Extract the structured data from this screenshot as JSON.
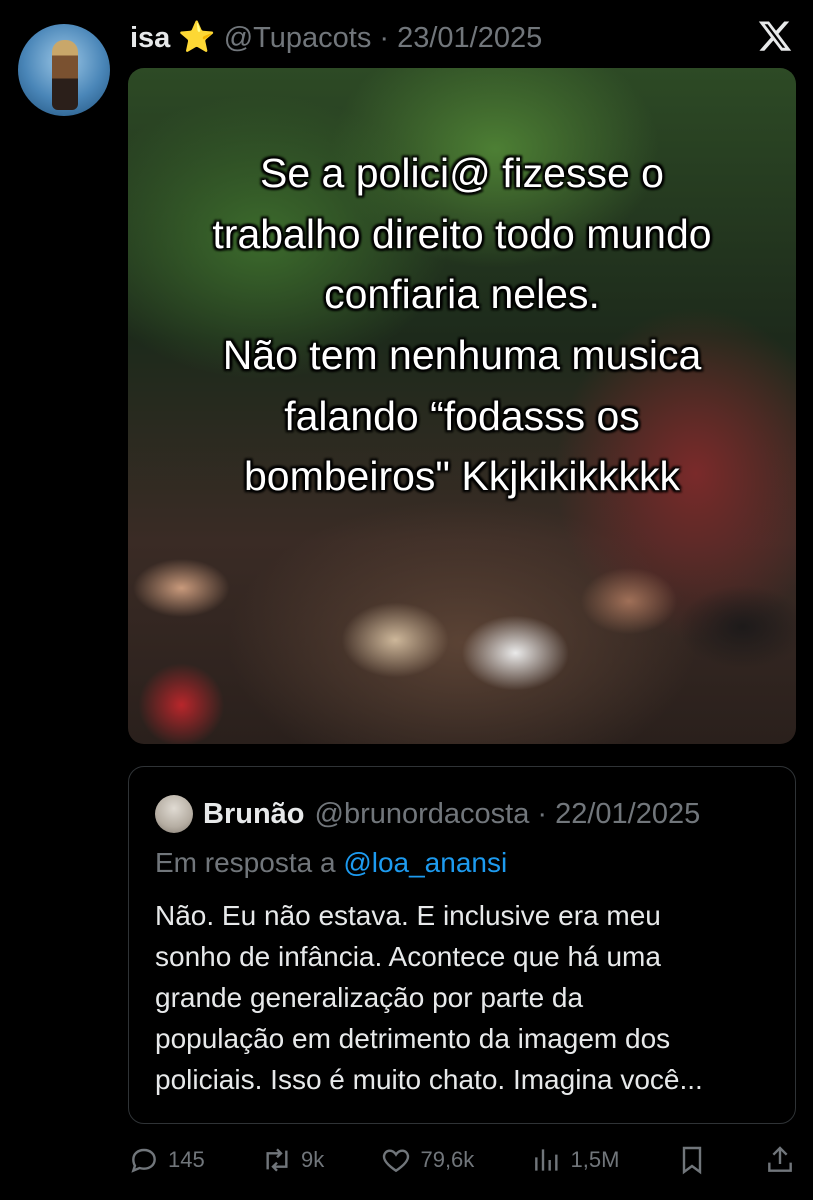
{
  "tweet": {
    "name": "isa",
    "badge": "⭐",
    "handle_date": "@Tupacots · 23/01/2025",
    "media_caption": "Se a polici@ fizesse o\ntrabalho direito todo mundo\nconfiaria neles.\nNão tem nenhuma musica\nfalando “fodasss os\nbombeiros\" Kkjkikikkkkk"
  },
  "quoted": {
    "name": "Brunão",
    "handle_date": "@brunordacosta · 22/01/2025",
    "reply_prefix": "Em resposta a",
    "reply_to": "@loa_anansi",
    "text": "Não. Eu não estava. E inclusive era meu\nsonho de infância. Acontece que há uma\ngrande generalização por parte da\npopulação em detrimento da imagem dos\npoliciais. Isso é muito chato. Imagina você..."
  },
  "actions": {
    "replies": "145",
    "reposts": "9k",
    "likes": "79,6k",
    "views": "1,5M"
  },
  "icons": [
    "x-logo-icon",
    "star-icon",
    "reply-icon",
    "repost-icon",
    "like-icon",
    "views-icon",
    "bookmark-icon",
    "share-icon"
  ]
}
